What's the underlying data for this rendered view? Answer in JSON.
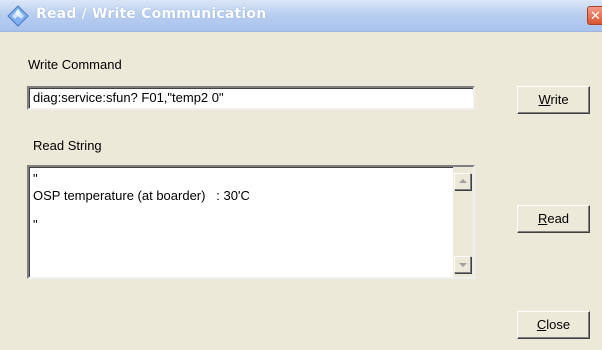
{
  "window": {
    "title": "Read / Write Communication",
    "close_glyph": "✕",
    "icon": "diamond-app-icon",
    "titlebar_color": "#b9cff0"
  },
  "write": {
    "label": "Write Command",
    "value": "diag:service:sfun? F01,\"temp2 0\"",
    "button": {
      "mnemonic": "W",
      "rest": "rite"
    }
  },
  "read": {
    "label": "Read String",
    "lines": [
      "\"",
      "OSP temperature (at boarder)   : 30'C",
      "\""
    ],
    "button": {
      "mnemonic": "R",
      "rest": "ead"
    }
  },
  "close_button": {
    "mnemonic": "C",
    "rest": "lose"
  }
}
